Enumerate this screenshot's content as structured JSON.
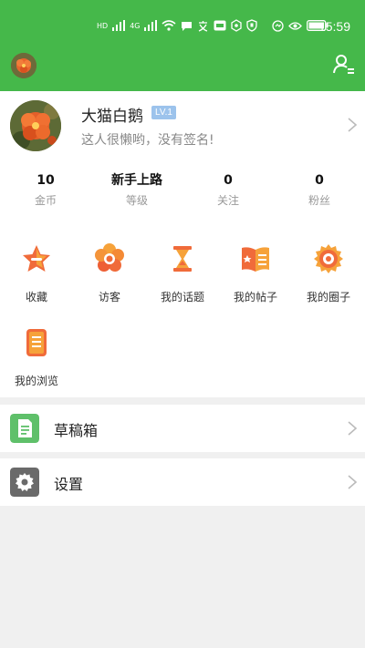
{
  "status_bar": {
    "network_badges": [
      "HD",
      "4G",
      "4G"
    ],
    "time": "15:59"
  },
  "topbar": {
    "avatar_icon": "avatar-image",
    "user_menu_icon": "user-list-icon"
  },
  "profile": {
    "name": "大猫白鹅",
    "level": "LV.1",
    "signature": "这人很懒哟，没有签名!"
  },
  "stats": [
    {
      "value": "10",
      "label": "金币"
    },
    {
      "value": "新手上路",
      "label": "等级"
    },
    {
      "value": "0",
      "label": "关注"
    },
    {
      "value": "0",
      "label": "粉丝"
    }
  ],
  "shortcuts": [
    {
      "label": "收藏",
      "icon": "star-icon"
    },
    {
      "label": "访客",
      "icon": "flower-icon"
    },
    {
      "label": "我的话题",
      "icon": "hourglass-icon"
    },
    {
      "label": "我的帖子",
      "icon": "book-icon"
    },
    {
      "label": "我的圈子",
      "icon": "gear-circle-icon"
    },
    {
      "label": "我的浏览",
      "icon": "document-icon"
    }
  ],
  "menu": [
    {
      "label": "草稿箱",
      "icon": "draft-icon",
      "color": "#5fc06a"
    },
    {
      "label": "设置",
      "icon": "settings-icon",
      "color": "#6a6a6a"
    }
  ],
  "colors": {
    "header": "#45b84a",
    "level_badge": "#9cc3ec"
  }
}
